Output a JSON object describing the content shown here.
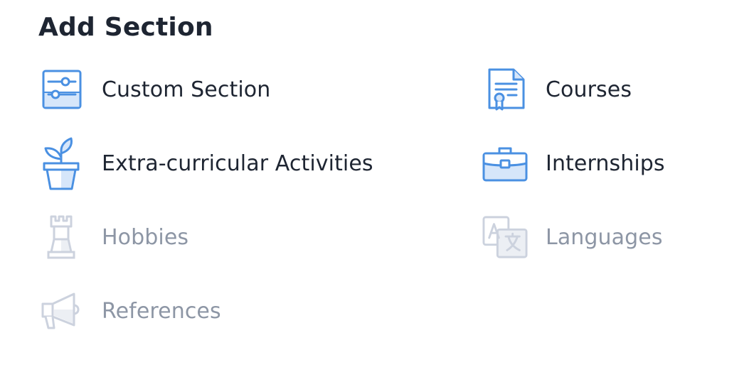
{
  "title": "Add Section",
  "colors": {
    "active_icon": "#4a90e2",
    "active_icon_fill": "#d6e6fa",
    "muted_icon": "#ccd2de",
    "text": "#1e2532",
    "muted_text": "#8d96a5"
  },
  "sections": [
    {
      "label": "Custom Section",
      "icon": "sliders-icon",
      "enabled": true
    },
    {
      "label": "Courses",
      "icon": "certificate-icon",
      "enabled": true
    },
    {
      "label": "Extra-curricular Activities",
      "icon": "plant-pot-icon",
      "enabled": true
    },
    {
      "label": "Internships",
      "icon": "briefcase-icon",
      "enabled": true
    },
    {
      "label": "Hobbies",
      "icon": "chess-rook-icon",
      "enabled": false
    },
    {
      "label": "Languages",
      "icon": "translate-icon",
      "enabled": false
    },
    {
      "label": "References",
      "icon": "megaphone-icon",
      "enabled": false
    }
  ]
}
